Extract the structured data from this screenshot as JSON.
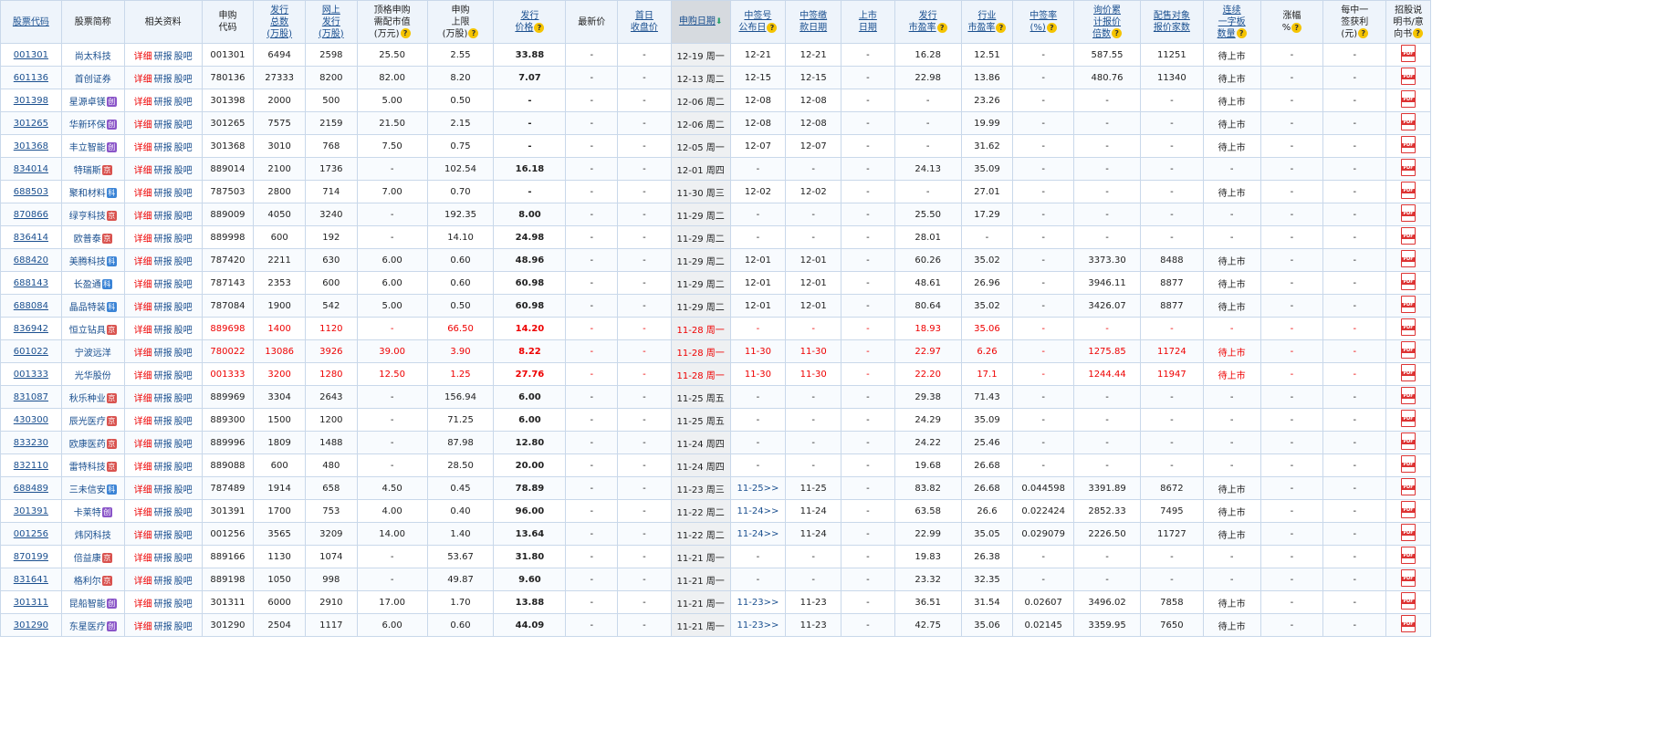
{
  "headers": [
    {
      "label": "股票代码",
      "link": true
    },
    {
      "label": "股票简称",
      "link": false
    },
    {
      "label": "相关资料",
      "link": false
    },
    {
      "label": "申购\n代码",
      "link": false
    },
    {
      "label": "发行\n总数\n(万股)",
      "link": true
    },
    {
      "label": "网上\n发行\n(万股)",
      "link": true
    },
    {
      "label": "顶格申购\n需配市值\n(万元)",
      "link": false,
      "help": true
    },
    {
      "label": "申购\n上限\n(万股)",
      "link": false,
      "help": true
    },
    {
      "label": "发行\n价格",
      "link": true,
      "help": true
    },
    {
      "label": "最新价",
      "link": false
    },
    {
      "label": "首日\n收盘价",
      "link": true
    },
    {
      "label": "申购日期",
      "link": true,
      "sort": "down"
    },
    {
      "label": "中签号\n公布日",
      "link": true,
      "help": true
    },
    {
      "label": "中签缴\n款日期",
      "link": true
    },
    {
      "label": "上市\n日期",
      "link": true
    },
    {
      "label": "发行\n市盈率",
      "link": true,
      "help": true
    },
    {
      "label": "行业\n市盈率",
      "link": true,
      "help": true
    },
    {
      "label": "中签率\n(%)",
      "link": true,
      "help": true
    },
    {
      "label": "询价累\n计报价\n倍数",
      "link": true,
      "help": true
    },
    {
      "label": "配售对象\n报价家数",
      "link": true
    },
    {
      "label": "连续\n一字板\n数量",
      "link": true,
      "help": true
    },
    {
      "label": "涨幅\n%",
      "link": false,
      "help": true
    },
    {
      "label": "每中一\n签获利\n(元)",
      "link": false,
      "help": true
    },
    {
      "label": "招股说\n明书/意\n向书",
      "link": false,
      "help": true
    }
  ],
  "link_labels": [
    "详细",
    "研报",
    "股吧"
  ],
  "badges": {
    "kc": "科",
    "cy": "创",
    "bj": "京"
  },
  "help_icon": "?",
  "sort_icon": "down-arrow-icon",
  "pdf_icon": "pdf-icon",
  "rows": [
    {
      "code": "001301",
      "name": "尚太科技",
      "badge": "",
      "sub_code": "001301",
      "total": "6494",
      "online": "2598",
      "top_value": "25.50",
      "limit": "2.55",
      "price": "33.88",
      "latest": "-",
      "first_close": "-",
      "date": "12-19 周一",
      "announce": "12-21",
      "announce_link": false,
      "pay": "12-21",
      "listing": "-",
      "pe": "16.28",
      "ind_pe": "12.51",
      "rate": "-",
      "inquiry": "587.55",
      "inst": "11251",
      "boards": "待上市",
      "gain": "-",
      "profit": "-",
      "red": false
    },
    {
      "code": "601136",
      "name": "首创证券",
      "badge": "",
      "sub_code": "780136",
      "total": "27333",
      "online": "8200",
      "top_value": "82.00",
      "limit": "8.20",
      "price": "7.07",
      "latest": "-",
      "first_close": "-",
      "date": "12-13 周二",
      "announce": "12-15",
      "announce_link": false,
      "pay": "12-15",
      "listing": "-",
      "pe": "22.98",
      "ind_pe": "13.86",
      "rate": "-",
      "inquiry": "480.76",
      "inst": "11340",
      "boards": "待上市",
      "gain": "-",
      "profit": "-",
      "red": false
    },
    {
      "code": "301398",
      "name": "星源卓镁",
      "badge": "cy",
      "sub_code": "301398",
      "total": "2000",
      "online": "500",
      "top_value": "5.00",
      "limit": "0.50",
      "price": "-",
      "latest": "-",
      "first_close": "-",
      "date": "12-06 周二",
      "announce": "12-08",
      "announce_link": false,
      "pay": "12-08",
      "listing": "-",
      "pe": "-",
      "ind_pe": "23.26",
      "rate": "-",
      "inquiry": "-",
      "inst": "-",
      "boards": "待上市",
      "gain": "-",
      "profit": "-",
      "red": false
    },
    {
      "code": "301265",
      "name": "华新环保",
      "badge": "cy",
      "sub_code": "301265",
      "total": "7575",
      "online": "2159",
      "top_value": "21.50",
      "limit": "2.15",
      "price": "-",
      "latest": "-",
      "first_close": "-",
      "date": "12-06 周二",
      "announce": "12-08",
      "announce_link": false,
      "pay": "12-08",
      "listing": "-",
      "pe": "-",
      "ind_pe": "19.99",
      "rate": "-",
      "inquiry": "-",
      "inst": "-",
      "boards": "待上市",
      "gain": "-",
      "profit": "-",
      "red": false
    },
    {
      "code": "301368",
      "name": "丰立智能",
      "badge": "cy",
      "sub_code": "301368",
      "total": "3010",
      "online": "768",
      "top_value": "7.50",
      "limit": "0.75",
      "price": "-",
      "latest": "-",
      "first_close": "-",
      "date": "12-05 周一",
      "announce": "12-07",
      "announce_link": false,
      "pay": "12-07",
      "listing": "-",
      "pe": "-",
      "ind_pe": "31.62",
      "rate": "-",
      "inquiry": "-",
      "inst": "-",
      "boards": "待上市",
      "gain": "-",
      "profit": "-",
      "red": false
    },
    {
      "code": "834014",
      "name": "特瑞斯",
      "badge": "bj",
      "sub_code": "889014",
      "total": "2100",
      "online": "1736",
      "top_value": "-",
      "limit": "102.54",
      "price": "16.18",
      "latest": "-",
      "first_close": "-",
      "date": "12-01 周四",
      "announce": "-",
      "announce_link": false,
      "pay": "-",
      "listing": "-",
      "pe": "24.13",
      "ind_pe": "35.09",
      "rate": "-",
      "inquiry": "-",
      "inst": "-",
      "boards": "-",
      "gain": "-",
      "profit": "-",
      "red": false
    },
    {
      "code": "688503",
      "name": "聚和材料",
      "badge": "kc",
      "sub_code": "787503",
      "total": "2800",
      "online": "714",
      "top_value": "7.00",
      "limit": "0.70",
      "price": "-",
      "latest": "-",
      "first_close": "-",
      "date": "11-30 周三",
      "announce": "12-02",
      "announce_link": false,
      "pay": "12-02",
      "listing": "-",
      "pe": "-",
      "ind_pe": "27.01",
      "rate": "-",
      "inquiry": "-",
      "inst": "-",
      "boards": "待上市",
      "gain": "-",
      "profit": "-",
      "red": false
    },
    {
      "code": "870866",
      "name": "绿亨科技",
      "badge": "bj",
      "sub_code": "889009",
      "total": "4050",
      "online": "3240",
      "top_value": "-",
      "limit": "192.35",
      "price": "8.00",
      "latest": "-",
      "first_close": "-",
      "date": "11-29 周二",
      "announce": "-",
      "announce_link": false,
      "pay": "-",
      "listing": "-",
      "pe": "25.50",
      "ind_pe": "17.29",
      "rate": "-",
      "inquiry": "-",
      "inst": "-",
      "boards": "-",
      "gain": "-",
      "profit": "-",
      "red": false
    },
    {
      "code": "836414",
      "name": "欧普泰",
      "badge": "bj",
      "sub_code": "889998",
      "total": "600",
      "online": "192",
      "top_value": "-",
      "limit": "14.10",
      "price": "24.98",
      "latest": "-",
      "first_close": "-",
      "date": "11-29 周二",
      "announce": "-",
      "announce_link": false,
      "pay": "-",
      "listing": "-",
      "pe": "28.01",
      "ind_pe": "-",
      "rate": "-",
      "inquiry": "-",
      "inst": "-",
      "boards": "-",
      "gain": "-",
      "profit": "-",
      "red": false
    },
    {
      "code": "688420",
      "name": "美腾科技",
      "badge": "kc",
      "sub_code": "787420",
      "total": "2211",
      "online": "630",
      "top_value": "6.00",
      "limit": "0.60",
      "price": "48.96",
      "latest": "-",
      "first_close": "-",
      "date": "11-29 周二",
      "announce": "12-01",
      "announce_link": false,
      "pay": "12-01",
      "listing": "-",
      "pe": "60.26",
      "ind_pe": "35.02",
      "rate": "-",
      "inquiry": "3373.30",
      "inst": "8488",
      "boards": "待上市",
      "gain": "-",
      "profit": "-",
      "red": false
    },
    {
      "code": "688143",
      "name": "长盈通",
      "badge": "kc",
      "sub_code": "787143",
      "total": "2353",
      "online": "600",
      "top_value": "6.00",
      "limit": "0.60",
      "price": "60.98",
      "latest": "-",
      "first_close": "-",
      "date": "11-29 周二",
      "announce": "12-01",
      "announce_link": false,
      "pay": "12-01",
      "listing": "-",
      "pe": "48.61",
      "ind_pe": "26.96",
      "rate": "-",
      "inquiry": "3946.11",
      "inst": "8877",
      "boards": "待上市",
      "gain": "-",
      "profit": "-",
      "red": false
    },
    {
      "code": "688084",
      "name": "晶品特装",
      "badge": "kc",
      "sub_code": "787084",
      "total": "1900",
      "online": "542",
      "top_value": "5.00",
      "limit": "0.50",
      "price": "60.98",
      "latest": "-",
      "first_close": "-",
      "date": "11-29 周二",
      "announce": "12-01",
      "announce_link": false,
      "pay": "12-01",
      "listing": "-",
      "pe": "80.64",
      "ind_pe": "35.02",
      "rate": "-",
      "inquiry": "3426.07",
      "inst": "8877",
      "boards": "待上市",
      "gain": "-",
      "profit": "-",
      "red": false
    },
    {
      "code": "836942",
      "name": "恒立钻具",
      "badge": "bj",
      "sub_code": "889698",
      "total": "1400",
      "online": "1120",
      "top_value": "-",
      "limit": "66.50",
      "price": "14.20",
      "latest": "-",
      "first_close": "-",
      "date": "11-28 周一",
      "announce": "-",
      "announce_link": false,
      "pay": "-",
      "listing": "-",
      "pe": "18.93",
      "ind_pe": "35.06",
      "rate": "-",
      "inquiry": "-",
      "inst": "-",
      "boards": "-",
      "gain": "-",
      "profit": "-",
      "red": true
    },
    {
      "code": "601022",
      "name": "宁波远洋",
      "badge": "",
      "sub_code": "780022",
      "total": "13086",
      "online": "3926",
      "top_value": "39.00",
      "limit": "3.90",
      "price": "8.22",
      "latest": "-",
      "first_close": "-",
      "date": "11-28 周一",
      "announce": "11-30",
      "announce_link": false,
      "pay": "11-30",
      "listing": "-",
      "pe": "22.97",
      "ind_pe": "6.26",
      "rate": "-",
      "inquiry": "1275.85",
      "inst": "11724",
      "boards": "待上市",
      "gain": "-",
      "profit": "-",
      "red": true
    },
    {
      "code": "001333",
      "name": "光华股份",
      "badge": "",
      "sub_code": "001333",
      "total": "3200",
      "online": "1280",
      "top_value": "12.50",
      "limit": "1.25",
      "price": "27.76",
      "latest": "-",
      "first_close": "-",
      "date": "11-28 周一",
      "announce": "11-30",
      "announce_link": false,
      "pay": "11-30",
      "listing": "-",
      "pe": "22.20",
      "ind_pe": "17.1",
      "rate": "-",
      "inquiry": "1244.44",
      "inst": "11947",
      "boards": "待上市",
      "gain": "-",
      "profit": "-",
      "red": true
    },
    {
      "code": "831087",
      "name": "秋乐种业",
      "badge": "bj",
      "sub_code": "889969",
      "total": "3304",
      "online": "2643",
      "top_value": "-",
      "limit": "156.94",
      "price": "6.00",
      "latest": "-",
      "first_close": "-",
      "date": "11-25 周五",
      "announce": "-",
      "announce_link": false,
      "pay": "-",
      "listing": "-",
      "pe": "29.38",
      "ind_pe": "71.43",
      "rate": "-",
      "inquiry": "-",
      "inst": "-",
      "boards": "-",
      "gain": "-",
      "profit": "-",
      "red": false
    },
    {
      "code": "430300",
      "name": "辰光医疗",
      "badge": "bj",
      "sub_code": "889300",
      "total": "1500",
      "online": "1200",
      "top_value": "-",
      "limit": "71.25",
      "price": "6.00",
      "latest": "-",
      "first_close": "-",
      "date": "11-25 周五",
      "announce": "-",
      "announce_link": false,
      "pay": "-",
      "listing": "-",
      "pe": "24.29",
      "ind_pe": "35.09",
      "rate": "-",
      "inquiry": "-",
      "inst": "-",
      "boards": "-",
      "gain": "-",
      "profit": "-",
      "red": false
    },
    {
      "code": "833230",
      "name": "欧康医药",
      "badge": "bj",
      "sub_code": "889996",
      "total": "1809",
      "online": "1488",
      "top_value": "-",
      "limit": "87.98",
      "price": "12.80",
      "latest": "-",
      "first_close": "-",
      "date": "11-24 周四",
      "announce": "-",
      "announce_link": false,
      "pay": "-",
      "listing": "-",
      "pe": "24.22",
      "ind_pe": "25.46",
      "rate": "-",
      "inquiry": "-",
      "inst": "-",
      "boards": "-",
      "gain": "-",
      "profit": "-",
      "red": false
    },
    {
      "code": "832110",
      "name": "雷特科技",
      "badge": "bj",
      "sub_code": "889088",
      "total": "600",
      "online": "480",
      "top_value": "-",
      "limit": "28.50",
      "price": "20.00",
      "latest": "-",
      "first_close": "-",
      "date": "11-24 周四",
      "announce": "-",
      "announce_link": false,
      "pay": "-",
      "listing": "-",
      "pe": "19.68",
      "ind_pe": "26.68",
      "rate": "-",
      "inquiry": "-",
      "inst": "-",
      "boards": "-",
      "gain": "-",
      "profit": "-",
      "red": false
    },
    {
      "code": "688489",
      "name": "三未信安",
      "badge": "kc",
      "sub_code": "787489",
      "total": "1914",
      "online": "658",
      "top_value": "4.50",
      "limit": "0.45",
      "price": "78.89",
      "latest": "-",
      "first_close": "-",
      "date": "11-23 周三",
      "announce": "11-25>>",
      "announce_link": true,
      "pay": "11-25",
      "listing": "-",
      "pe": "83.82",
      "ind_pe": "26.68",
      "rate": "0.044598",
      "inquiry": "3391.89",
      "inst": "8672",
      "boards": "待上市",
      "gain": "-",
      "profit": "-",
      "red": false
    },
    {
      "code": "301391",
      "name": "卡莱特",
      "badge": "cy",
      "sub_code": "301391",
      "total": "1700",
      "online": "753",
      "top_value": "4.00",
      "limit": "0.40",
      "price": "96.00",
      "latest": "-",
      "first_close": "-",
      "date": "11-22 周二",
      "announce": "11-24>>",
      "announce_link": true,
      "pay": "11-24",
      "listing": "-",
      "pe": "63.58",
      "ind_pe": "26.6",
      "rate": "0.022424",
      "inquiry": "2852.33",
      "inst": "7495",
      "boards": "待上市",
      "gain": "-",
      "profit": "-",
      "red": false
    },
    {
      "code": "001256",
      "name": "炜冈科技",
      "badge": "",
      "sub_code": "001256",
      "total": "3565",
      "online": "3209",
      "top_value": "14.00",
      "limit": "1.40",
      "price": "13.64",
      "latest": "-",
      "first_close": "-",
      "date": "11-22 周二",
      "announce": "11-24>>",
      "announce_link": true,
      "pay": "11-24",
      "listing": "-",
      "pe": "22.99",
      "ind_pe": "35.05",
      "rate": "0.029079",
      "inquiry": "2226.50",
      "inst": "11727",
      "boards": "待上市",
      "gain": "-",
      "profit": "-",
      "red": false
    },
    {
      "code": "870199",
      "name": "倍益康",
      "badge": "bj",
      "sub_code": "889166",
      "total": "1130",
      "online": "1074",
      "top_value": "-",
      "limit": "53.67",
      "price": "31.80",
      "latest": "-",
      "first_close": "-",
      "date": "11-21 周一",
      "announce": "-",
      "announce_link": false,
      "pay": "-",
      "listing": "-",
      "pe": "19.83",
      "ind_pe": "26.38",
      "rate": "-",
      "inquiry": "-",
      "inst": "-",
      "boards": "-",
      "gain": "-",
      "profit": "-",
      "red": false
    },
    {
      "code": "831641",
      "name": "格利尔",
      "badge": "bj",
      "sub_code": "889198",
      "total": "1050",
      "online": "998",
      "top_value": "-",
      "limit": "49.87",
      "price": "9.60",
      "latest": "-",
      "first_close": "-",
      "date": "11-21 周一",
      "announce": "-",
      "announce_link": false,
      "pay": "-",
      "listing": "-",
      "pe": "23.32",
      "ind_pe": "32.35",
      "rate": "-",
      "inquiry": "-",
      "inst": "-",
      "boards": "-",
      "gain": "-",
      "profit": "-",
      "red": false
    },
    {
      "code": "301311",
      "name": "昆船智能",
      "badge": "cy",
      "sub_code": "301311",
      "total": "6000",
      "online": "2910",
      "top_value": "17.00",
      "limit": "1.70",
      "price": "13.88",
      "latest": "-",
      "first_close": "-",
      "date": "11-21 周一",
      "announce": "11-23>>",
      "announce_link": true,
      "pay": "11-23",
      "listing": "-",
      "pe": "36.51",
      "ind_pe": "31.54",
      "rate": "0.02607",
      "inquiry": "3496.02",
      "inst": "7858",
      "boards": "待上市",
      "gain": "-",
      "profit": "-",
      "red": false
    },
    {
      "code": "301290",
      "name": "东星医疗",
      "badge": "cy",
      "sub_code": "301290",
      "total": "2504",
      "online": "1117",
      "top_value": "6.00",
      "limit": "0.60",
      "price": "44.09",
      "latest": "-",
      "first_close": "-",
      "date": "11-21 周一",
      "announce": "11-23>>",
      "announce_link": true,
      "pay": "11-23",
      "listing": "-",
      "pe": "42.75",
      "ind_pe": "35.06",
      "rate": "0.02145",
      "inquiry": "3359.95",
      "inst": "7650",
      "boards": "待上市",
      "gain": "-",
      "profit": "-",
      "red": false
    }
  ]
}
